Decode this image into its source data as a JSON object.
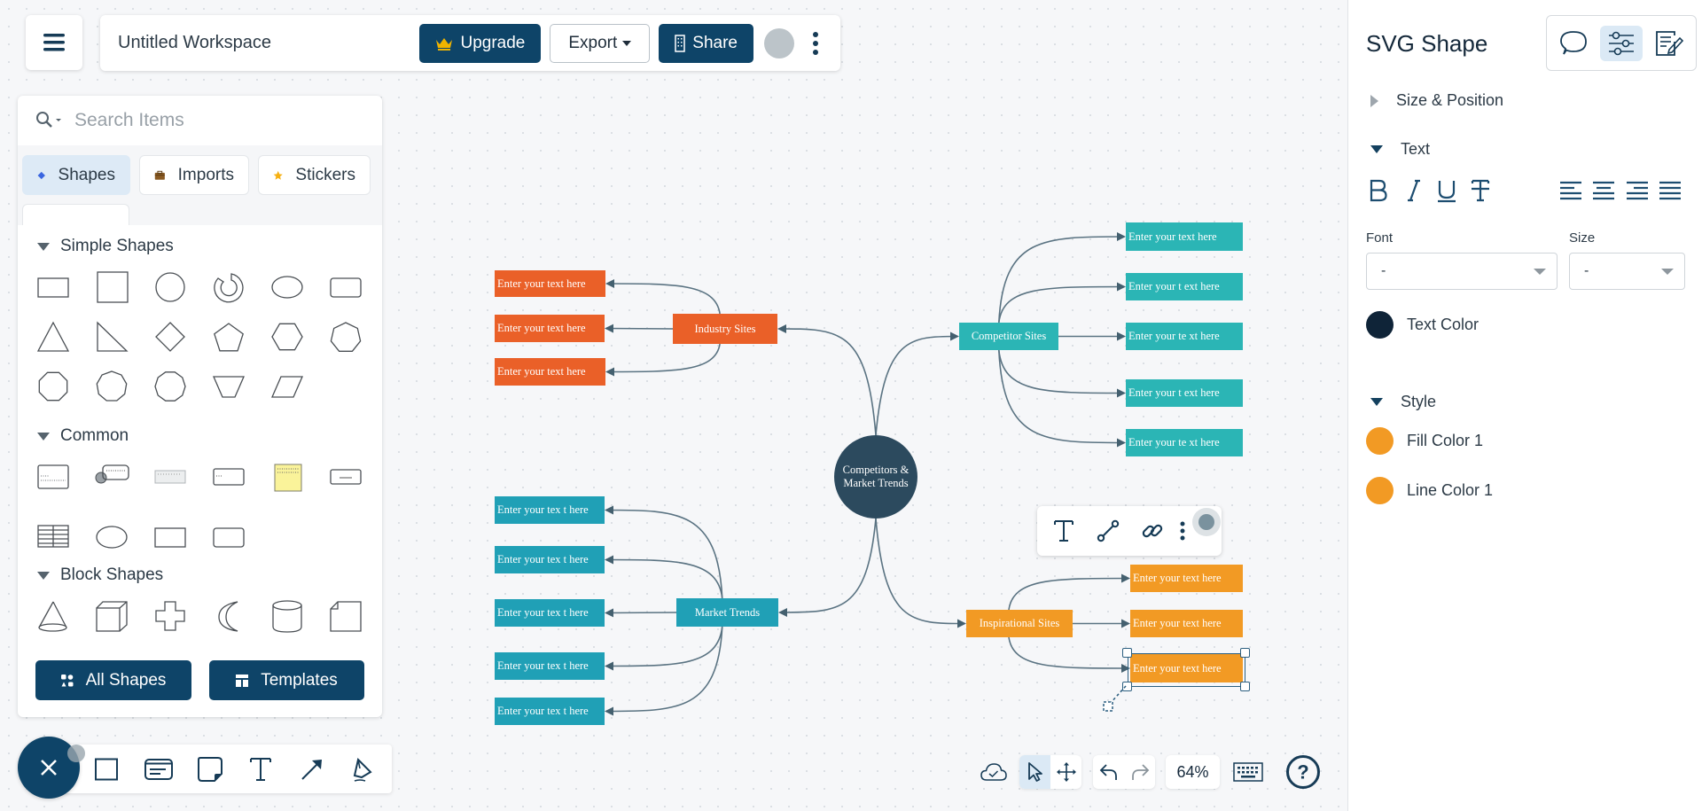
{
  "topbar": {
    "menu_icon": "hamburger-icon",
    "workspace_title": "Untitled Workspace",
    "upgrade_label": "Upgrade",
    "export_label": "Export",
    "share_label": "Share",
    "colors": {
      "primary": "#0e4468",
      "crown": "#f0b400"
    }
  },
  "left_panel": {
    "search": {
      "placeholder": "Search Items",
      "value": ""
    },
    "tabs": [
      {
        "label": "Shapes",
        "icon": "diamond-icon",
        "active": true
      },
      {
        "label": "Imports",
        "icon": "briefcase-icon",
        "active": false
      },
      {
        "label": "Stickers",
        "icon": "star-icon",
        "active": false
      }
    ],
    "sections": [
      {
        "title": "Simple Shapes",
        "shapes": [
          "rectangle",
          "square",
          "circle",
          "donut",
          "ellipse",
          "rounded-rectangle",
          "triangle",
          "right-triangle",
          "diamond",
          "pentagon",
          "hexagon",
          "heptagon",
          "octagon",
          "nonagon",
          "decagon",
          "trapezoid",
          "parallelogram"
        ]
      },
      {
        "title": "Common",
        "shapes": [
          "text-card",
          "callout-card",
          "ruler-card",
          "label-card",
          "sticky-note",
          "button-card",
          "table",
          "ellipse",
          "rectangle",
          "rounded-rectangle"
        ]
      },
      {
        "title": "Block Shapes",
        "shapes": [
          "cone",
          "cube",
          "cross",
          "crescent",
          "cylinder",
          "folded-corner"
        ]
      }
    ],
    "all_shapes_label": "All Shapes",
    "templates_label": "Templates"
  },
  "draw_toolbar": {
    "tools": [
      "rectangle-tool",
      "card-tool",
      "sticky-tool",
      "text-tool",
      "arrow-tool",
      "pen-tool"
    ],
    "close_icon": "close-icon"
  },
  "mindmap": {
    "center": {
      "line1": "Competitors &",
      "line2": "Market Trends",
      "color": "#2c4a5e"
    },
    "branches": [
      {
        "label": "Industry Sites",
        "color": "#ea6028",
        "children": [
          "Enter your text here",
          "Enter your text here",
          "Enter your text here"
        ]
      },
      {
        "label": "Competitor Sites",
        "color": "#2bb5b5",
        "children": [
          "Enter your text here",
          "Enter your t ext here",
          "Enter your te xt here",
          "Enter your t ext here",
          "Enter your te xt here"
        ]
      },
      {
        "label": "Market Trends",
        "color": "#20a0b6",
        "children": [
          "Enter your tex t here",
          "Enter your tex t here",
          "Enter your tex t here",
          "Enter your tex t here",
          "Enter your tex t here"
        ]
      },
      {
        "label": "Inspirational Sites",
        "color": "#f29a24",
        "children": [
          "Enter your text here",
          "Enter your text here",
          "Enter your text here"
        ]
      }
    ],
    "connector_color": "#5a7382"
  },
  "floating_toolbar": {
    "tools": [
      "text-icon",
      "connector-icon",
      "link-icon",
      "more-icon"
    ]
  },
  "canvas_controls": {
    "zoom": "64%",
    "tools": [
      "cloud-saved-icon",
      "select-icon",
      "pan-icon",
      "undo-icon",
      "redo-icon",
      "keyboard-icon",
      "help-icon"
    ]
  },
  "right_panel": {
    "title": "SVG Shape",
    "tabs": [
      {
        "icon": "comment-icon",
        "active": false
      },
      {
        "icon": "settings-sliders-icon",
        "active": true
      },
      {
        "icon": "edit-notes-icon",
        "active": false
      }
    ],
    "size_position_label": "Size & Position",
    "text_section_label": "Text",
    "format_buttons": [
      "bold",
      "italic",
      "underline",
      "strikethrough"
    ],
    "align_buttons": [
      "align-left",
      "align-center",
      "align-right",
      "justify"
    ],
    "font_label": "Font",
    "font_value": "-",
    "size_label": "Size",
    "size_value": "-",
    "text_color_label": "Text Color",
    "text_color": "#0f2438",
    "style_section_label": "Style",
    "fill_color_label": "Fill Color 1",
    "fill_color": "#f29a24",
    "line_color_label": "Line Color 1",
    "line_color": "#f29a24"
  }
}
